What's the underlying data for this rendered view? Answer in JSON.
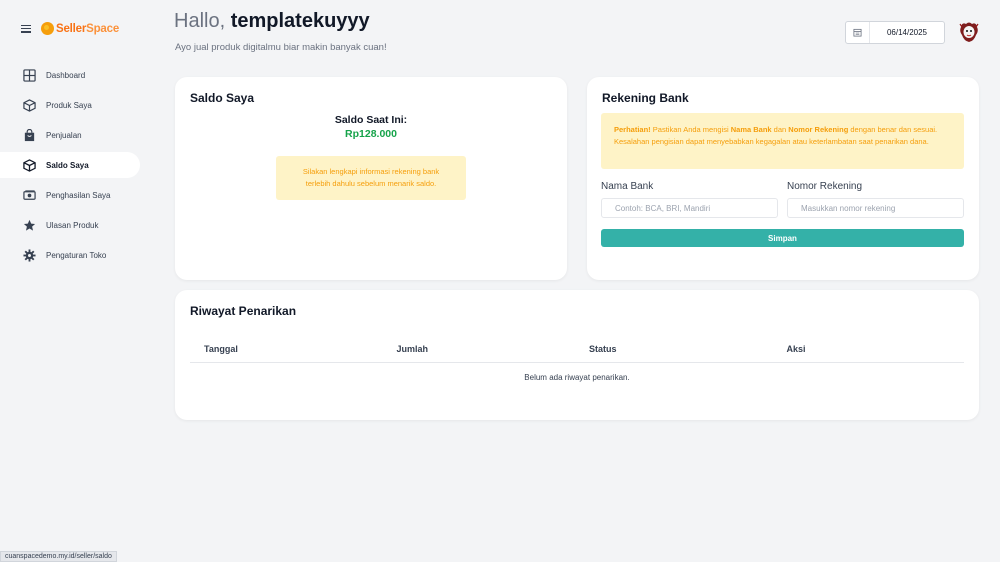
{
  "brand": {
    "part1": "Seller",
    "part2": "Space"
  },
  "sidebar": {
    "items": [
      {
        "label": "Dashboard",
        "icon": "grid-icon"
      },
      {
        "label": "Produk Saya",
        "icon": "box-icon"
      },
      {
        "label": "Penjualan",
        "icon": "bag-icon"
      },
      {
        "label": "Saldo Saya",
        "icon": "cube-icon",
        "active": true
      },
      {
        "label": "Penghasilan Saya",
        "icon": "money-icon"
      },
      {
        "label": "Ulasan Produk",
        "icon": "star-icon"
      },
      {
        "label": "Pengaturan Toko",
        "icon": "gear-icon"
      }
    ]
  },
  "header": {
    "greeting_prefix": "Hallo,",
    "username": "templatekuyyy",
    "subtitle": "Ayo jual produk digitalmu biar makin banyak cuan!",
    "date": "06/14/2025"
  },
  "saldo": {
    "title": "Saldo Saya",
    "label": "Saldo Saat Ini:",
    "amount": "Rp128.000",
    "warning": "Silakan lengkapi informasi rekening bank terlebih dahulu sebelum menarik saldo."
  },
  "bank": {
    "title": "Rekening Bank",
    "warn_bold1": "Perhatian!",
    "warn_text1": " Pastikan Anda mengisi ",
    "warn_bold2": "Nama Bank",
    "warn_text2": " dan ",
    "warn_bold3": "Nomor Rekening",
    "warn_text3": " dengan benar dan sesuai. Kesalahan pengisian dapat menyebabkan kegagalan atau keterlambatan saat penarikan dana.",
    "bank_name_label": "Nama Bank",
    "bank_name_placeholder": "Contoh: BCA, BRI, Mandiri",
    "account_label": "Nomor Rekening",
    "account_placeholder": "Masukkan nomor rekening",
    "save_label": "Simpan"
  },
  "history": {
    "title": "Riwayat Penarikan",
    "columns": [
      "Tanggal",
      "Jumlah",
      "Status",
      "Aksi"
    ],
    "empty": "Belum ada riwayat penarikan."
  },
  "statusbar": {
    "url": "cuanspacedemo.my.id/seller/saldo"
  },
  "colors": {
    "accent": "#34b1a8",
    "warning_bg": "#fef3c7",
    "warning_text": "#f59e0b",
    "balance": "#16a34a",
    "brand": "#f97316"
  }
}
